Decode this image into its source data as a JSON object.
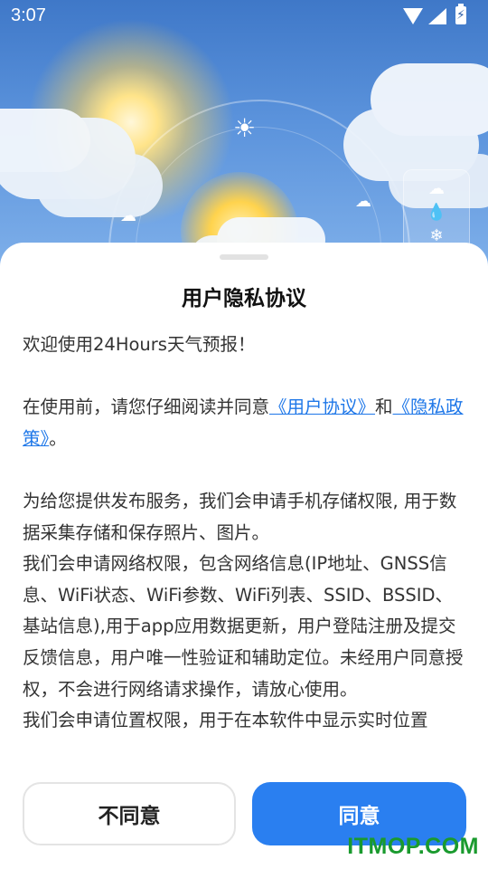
{
  "status_bar": {
    "time": "3:07"
  },
  "background": {
    "sun_icon": "sun-icon",
    "cloud_icon": "cloud-icon",
    "side_panel_icons": [
      "cloud-outline-icon",
      "drop-icon",
      "snowflake-icon"
    ]
  },
  "dialog": {
    "title": "用户隐私协议",
    "welcome": "欢迎使用24Hours天气预报！",
    "intro_prefix": "在使用前，请您仔细阅读并同意",
    "link_user_agreement": "《用户协议》",
    "and_text": "和",
    "link_privacy_policy": "《隐私政策》",
    "intro_suffix": "。",
    "para_storage": "为给您提供发布服务，我们会申请手机存储权限, 用于数据采集存储和保存照片、图片。",
    "para_network": "我们会申请网络权限，包含网络信息(IP地址、GNSS信息、WiFi状态、WiFi参数、WiFi列表、SSID、BSSID、基站信息),用于app应用数据更新，用户登陆注册及提交反馈信息，用户唯一性验证和辅助定位。未经用户同意授权，不会进行网络请求操作，请放心使用。",
    "para_location": "我们会申请位置权限，用于在本软件中显示实时位置",
    "decline_label": "不同意",
    "agree_label": "同意"
  },
  "watermark": "ITMOP.COM",
  "colors": {
    "accent": "#2a7ff0",
    "link": "#1e77e8",
    "watermark": "#1a9a2e"
  }
}
